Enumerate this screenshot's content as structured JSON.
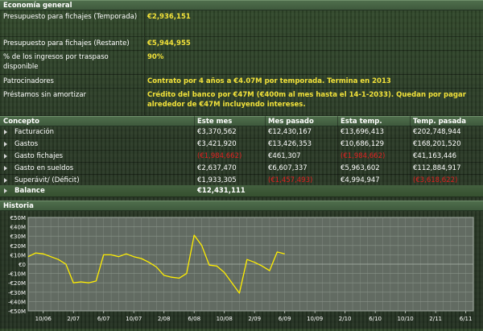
{
  "economy": {
    "title": "Economía general",
    "rows": [
      {
        "label": "Presupuesto para fichajes (Temporada)",
        "value": "€2,936,151"
      },
      {
        "label": "Presupuesto para fichajes (Restante)",
        "value": "€5,944,955"
      },
      {
        "label": "% de los ingresos por traspaso disponible",
        "value": "90%"
      },
      {
        "label": "Patrocinadores",
        "value": "Contrato por 4 años a €4.07M por temporada. Termina en 2013"
      },
      {
        "label": "Préstamos sin amortizar",
        "value": "Crédito del banco por €47M (€400m al mes hasta el 14-1-2033). Quedan por pagar alrededor de €47M incluyendo intereses."
      }
    ]
  },
  "table": {
    "headers": [
      "Concepto",
      "Este mes",
      "Mes pasado",
      "Esta temp.",
      "Temp. pasada"
    ],
    "rows": [
      {
        "label": "Facturación",
        "values": [
          "€3,370,562",
          "€12,430,167",
          "€13,696,413",
          "€202,748,944"
        ],
        "neg": [
          false,
          false,
          false,
          false
        ]
      },
      {
        "label": "Gastos",
        "values": [
          "€3,421,920",
          "€13,426,353",
          "€10,686,129",
          "€168,201,520"
        ],
        "neg": [
          false,
          false,
          false,
          false
        ]
      },
      {
        "label": "Gasto fichajes",
        "values": [
          "(€1,984,662)",
          "€461,307",
          "(€1,984,662)",
          "€41,163,446"
        ],
        "neg": [
          true,
          false,
          true,
          false
        ]
      },
      {
        "label": "Gasto en sueldos",
        "values": [
          "€2,637,470",
          "€6,607,337",
          "€5,963,602",
          "€112,884,917"
        ],
        "neg": [
          false,
          false,
          false,
          false
        ]
      },
      {
        "label": "Superávit/ (Déficit)",
        "values": [
          "€1,933,305",
          "(€1,457,493)",
          "€4,994,947",
          "(€3,618,622)"
        ],
        "neg": [
          false,
          true,
          false,
          true
        ]
      }
    ],
    "balance": {
      "label": "Balance",
      "value": "€12,431,111"
    }
  },
  "history": {
    "title": "Historia"
  },
  "chart_data": {
    "type": "line",
    "title": "",
    "xlabel": "",
    "ylabel": "",
    "ylim": [
      -50,
      50
    ],
    "yticks": [
      "€50M",
      "€40M",
      "€30M",
      "€20M",
      "€10M",
      "€0",
      "-€10M",
      "-€20M",
      "-€30M",
      "-€40M",
      "-€50M"
    ],
    "ytick_values": [
      50,
      40,
      30,
      20,
      10,
      0,
      -10,
      -20,
      -30,
      -40,
      -50
    ],
    "xticks": [
      "10/06",
      "2/07",
      "6/07",
      "10/07",
      "2/08",
      "6/08",
      "10/08",
      "2/09",
      "6/09",
      "10/09",
      "2/10",
      "6/10",
      "10/10",
      "2/11",
      "6/11"
    ],
    "x_start": "8/06",
    "x_end": "7/11",
    "series": [
      {
        "values": [
          [
            "8/06",
            8
          ],
          [
            "9/06",
            12
          ],
          [
            "10/06",
            11
          ],
          [
            "11/06",
            8
          ],
          [
            "12/06",
            5
          ],
          [
            "1/07",
            0
          ],
          [
            "2/07",
            -20
          ],
          [
            "3/07",
            -19
          ],
          [
            "4/07",
            -20
          ],
          [
            "5/07",
            -18
          ],
          [
            "6/07",
            10
          ],
          [
            "7/07",
            10
          ],
          [
            "8/07",
            8
          ],
          [
            "9/07",
            11
          ],
          [
            "10/07",
            8
          ],
          [
            "11/07",
            6
          ],
          [
            "12/07",
            2
          ],
          [
            "1/08",
            -3
          ],
          [
            "2/08",
            -12
          ],
          [
            "3/08",
            -14
          ],
          [
            "4/08",
            -15
          ],
          [
            "5/08",
            -10
          ],
          [
            "6/08",
            31
          ],
          [
            "7/08",
            20
          ],
          [
            "8/08",
            -1
          ],
          [
            "9/08",
            -2
          ],
          [
            "10/08",
            -9
          ],
          [
            "11/08",
            -20
          ],
          [
            "12/08",
            -31
          ],
          [
            "1/09",
            5
          ],
          [
            "2/09",
            2
          ],
          [
            "3/09",
            -2
          ],
          [
            "4/09",
            -7
          ],
          [
            "5/09",
            13
          ],
          [
            "6/09",
            11
          ]
        ]
      }
    ],
    "colors": {
      "line": "#ffee00",
      "grid": "#8a948a",
      "plot_bg": "#626b62",
      "axis_text": "#ffffff"
    }
  }
}
